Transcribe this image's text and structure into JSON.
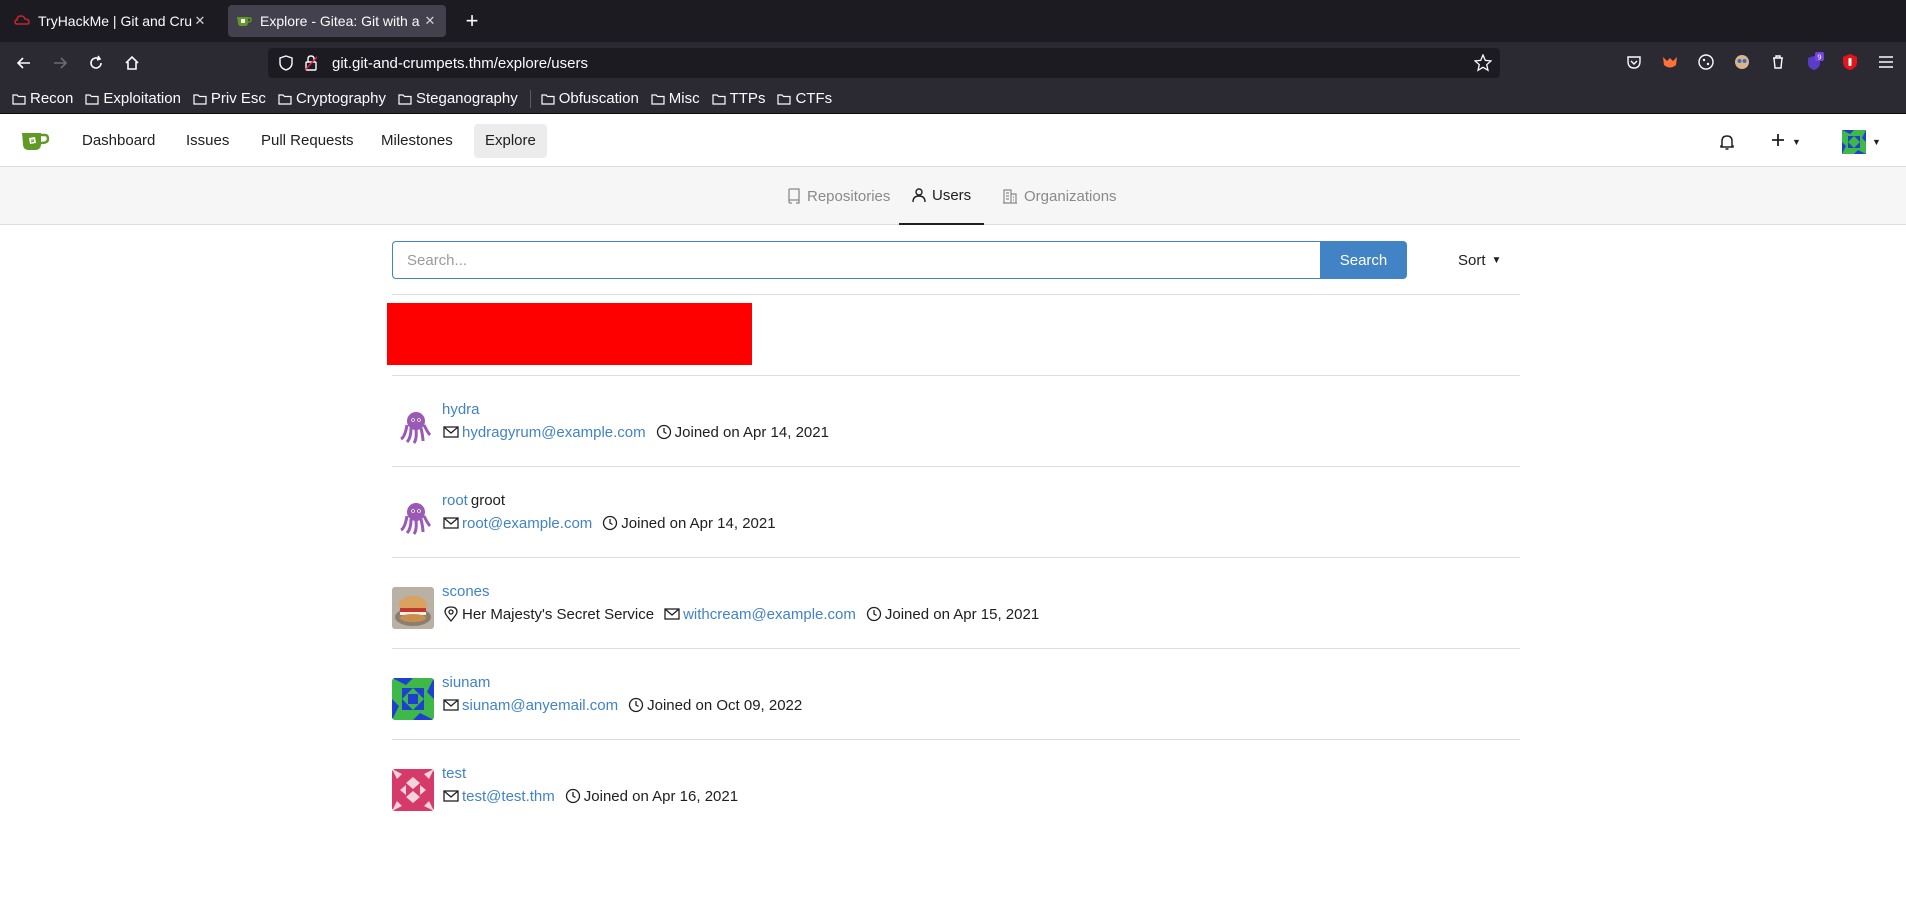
{
  "browser": {
    "tabs": [
      {
        "title": "TryHackMe | Git and Crumpets",
        "active": false,
        "favicon": "tryhackme-icon"
      },
      {
        "title": "Explore - Gitea: Git with a cup of tea",
        "active": true,
        "favicon": "gitea-icon"
      }
    ],
    "url_host": "git.git-and-crumpets.thm",
    "url_path": "/explore/users",
    "extension_badge": "9",
    "bookmarks": [
      "Recon",
      "Exploitation",
      "Priv Esc",
      "Cryptography",
      "Steganography",
      "Obfuscation",
      "Misc",
      "TTPs",
      "CTFs"
    ]
  },
  "gitea": {
    "nav": [
      "Dashboard",
      "Issues",
      "Pull Requests",
      "Milestones",
      "Explore"
    ],
    "active_nav": "Explore",
    "subnav": [
      {
        "label": "Repositories",
        "icon": "repo-icon",
        "active": false
      },
      {
        "label": "Users",
        "icon": "person-icon",
        "active": true
      },
      {
        "label": "Organizations",
        "icon": "organization-icon",
        "active": false
      }
    ],
    "search": {
      "placeholder": "Search...",
      "button": "Search"
    },
    "sort_label": "Sort",
    "users": [
      {
        "username": "hydra",
        "full_name": "",
        "location": "",
        "email": "hydragyrum@example.com",
        "joined": "Joined on Apr 14, 2021",
        "avatar": "octopus-avatar"
      },
      {
        "username": "root",
        "full_name": "groot",
        "location": "",
        "email": "root@example.com",
        "joined": "Joined on Apr 14, 2021",
        "avatar": "octopus-avatar"
      },
      {
        "username": "scones",
        "full_name": "",
        "location": "Her Majesty's Secret Service",
        "email": "withcream@example.com",
        "joined": "Joined on Apr 15, 2021",
        "avatar": "scone-photo-avatar"
      },
      {
        "username": "siunam",
        "full_name": "",
        "location": "",
        "email": "siunam@anyemail.com",
        "joined": "Joined on Oct 09, 2022",
        "avatar": "blue-green-identicon"
      },
      {
        "username": "test",
        "full_name": "",
        "location": "",
        "email": "test@test.thm",
        "joined": "Joined on Apr 16, 2021",
        "avatar": "pink-identicon"
      }
    ]
  },
  "colors": {
    "link": "#4183c4",
    "redaction": "#ff0000",
    "tab_strip": "#1c1b22",
    "toolbar": "#2b2a33"
  }
}
